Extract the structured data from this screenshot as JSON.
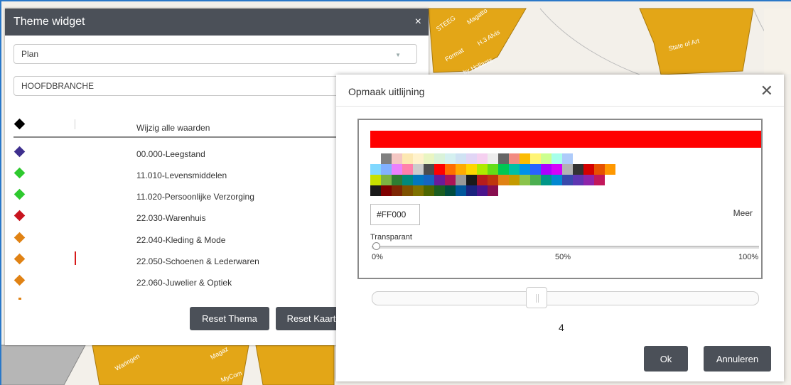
{
  "map": {
    "labels": [
      "STEEG",
      "Magatto",
      "Format",
      "H.3 Alvis",
      "by Hollants",
      "State of Art",
      "Waringen",
      "Magaz",
      "MyCom"
    ]
  },
  "theme_widget": {
    "title": "Theme widget",
    "close_glyph": "×",
    "select_1": "Plan",
    "select_2": "HOOFDBRANCHE",
    "legend": [
      {
        "label": "Wijzig alle waarden",
        "color": "#000000"
      },
      {
        "label": "00.000-Leegstand",
        "color": "#3e2f8e"
      },
      {
        "label": "11.010-Levensmiddelen",
        "color": "#2ec92e"
      },
      {
        "label": "11.020-Persoonlijke Verzorging",
        "color": "#2ec92e"
      },
      {
        "label": "22.030-Warenhuis",
        "color": "#c8141e"
      },
      {
        "label": "22.040-Kleding & Mode",
        "color": "#e08214"
      },
      {
        "label": "22.050-Schoenen & Lederwaren",
        "color": "#e08214"
      },
      {
        "label": "22.060-Juwelier & Optiek",
        "color": "#e08214"
      }
    ],
    "reset_theme": "Reset Thema",
    "reset_map": "Reset Kaart"
  },
  "dialog": {
    "title": "Opmaak uitlijning",
    "close_glyph": "✕",
    "selected_color": "#ff0000",
    "hex_value": "#FF000",
    "more_label": "Meer",
    "transparency_label": "Transparant",
    "transparency_value": 0,
    "ticks": [
      "0%",
      "50%",
      "100%"
    ],
    "line_width": "4",
    "ok_label": "Ok",
    "cancel_label": "Annuleren",
    "palette": [
      [
        "#ffffff",
        "#808080",
        "#f4c7c3",
        "#fce8b2",
        "#fff2cc",
        "#e9f5c2",
        "#d9f2d9",
        "#d4f0f0",
        "#cfe2f3",
        "#e1d5f5",
        "#f5d0f0",
        "#ededed",
        "#666666",
        "#f28b82",
        "#fbbc04",
        "#fff475",
        "#ccff90",
        "#a7ffeb",
        "#aecbfa"
      ],
      [
        "#80d8ff",
        "#82b1ff",
        "#ea80fc",
        "#ff80ab",
        "#cccccc",
        "#4d4d4d",
        "#ff0000",
        "#ff6d00",
        "#ffab00",
        "#ffd600",
        "#aeea00",
        "#64dd17",
        "#00c853",
        "#00bfa5",
        "#0091ea",
        "#2962ff",
        "#aa00ff",
        "#d500f9",
        "#b3b3b3",
        "#333333",
        "#d50000",
        "#e65100",
        "#ff9800"
      ],
      [
        "#c6e000",
        "#7cb342",
        "#2e7d32",
        "#00897b",
        "#0277bd",
        "#1565c0",
        "#6a1b9a",
        "#ad1457",
        "#999999",
        "#1a1a1a",
        "#b71c1c",
        "#bf360c",
        "#e08214",
        "#c49a00",
        "#8bc34a",
        "#4caf50",
        "#009688",
        "#0288d1",
        "#3949ab",
        "#5e35b1",
        "#8e24aa",
        "#c2185b"
      ],
      [
        "#1a1a1a",
        "#7f0000",
        "#7f2704",
        "#7f5200",
        "#7f7200",
        "#4d6600",
        "#1b5e20",
        "#004d40",
        "#01579b",
        "#1a237e",
        "#4a148c",
        "#880e4f"
      ]
    ]
  }
}
